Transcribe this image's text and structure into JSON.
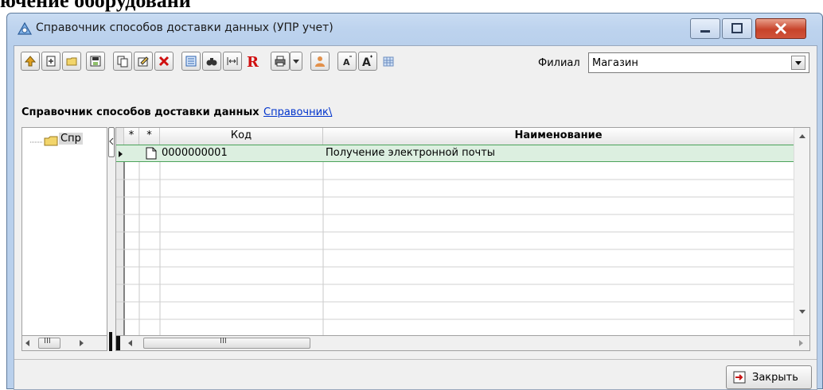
{
  "background_heading": "ючение оборудовани",
  "window": {
    "title": "Справочник способов доставки данных (УПР учет)"
  },
  "toolbar": {
    "buttons": [
      {
        "icon": "up-arrow-icon"
      },
      {
        "icon": "new-item-icon"
      },
      {
        "icon": "folder-icon"
      },
      {
        "icon": "save-icon"
      },
      {
        "icon": "copy-icon"
      },
      {
        "icon": "edit-icon"
      },
      {
        "icon": "delete-icon"
      },
      {
        "icon": "list-view-icon"
      },
      {
        "icon": "binoculars-icon"
      },
      {
        "icon": "fit-columns-icon"
      },
      {
        "icon": "report-r-icon"
      },
      {
        "icon": "print-icon"
      },
      {
        "icon": "dropdown-arrow-icon"
      },
      {
        "icon": "user-icon"
      },
      {
        "icon": "font-decrease-icon"
      },
      {
        "icon": "font-increase-icon"
      },
      {
        "icon": "calendar-grid-icon"
      }
    ],
    "filial_label": "Филиал",
    "filial_value": "Магазин"
  },
  "heading": {
    "title": "Справочник способов доставки данных",
    "link": "Справочник\\"
  },
  "tree": {
    "item_label": "Спр"
  },
  "grid": {
    "columns": [
      "*",
      "*",
      "Код",
      "Наименование"
    ],
    "rows": [
      {
        "code": "0000000001",
        "name": "Получение электронной почты"
      }
    ]
  },
  "scroll_thumb_glyph": "III",
  "close_button": {
    "label": "Закрыть"
  },
  "colors": {
    "selected_row": "#dcefe0",
    "close_button": "#c7432a",
    "link": "#0033cc"
  }
}
